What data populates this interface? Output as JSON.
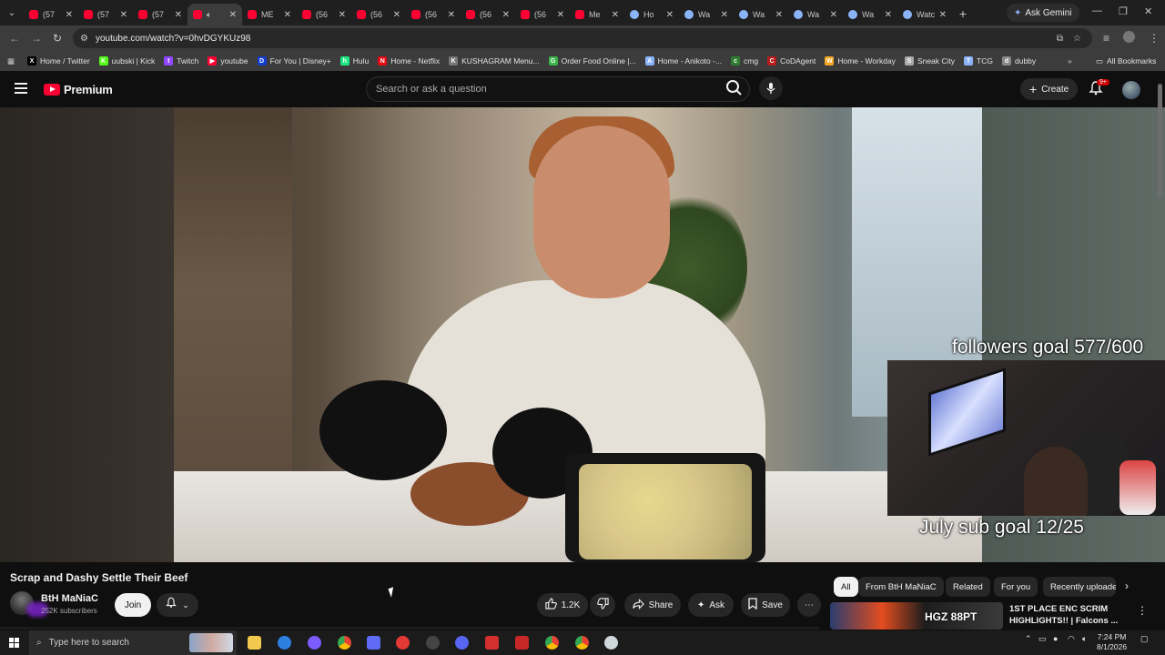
{
  "browser": {
    "tabs": [
      {
        "title": "(57",
        "icon": "youtube-icon"
      },
      {
        "title": "(57",
        "icon": "youtube-icon"
      },
      {
        "title": "(57",
        "icon": "youtube-icon"
      },
      {
        "title": "",
        "icon": "youtube-icon",
        "active": true,
        "muted_icon": "speaker-icon"
      },
      {
        "title": "ME",
        "icon": "youtube-icon"
      },
      {
        "title": "(56",
        "icon": "youtube-icon"
      },
      {
        "title": "(56",
        "icon": "youtube-icon"
      },
      {
        "title": "(56",
        "icon": "youtube-icon"
      },
      {
        "title": "(56",
        "icon": "youtube-icon"
      },
      {
        "title": "(56",
        "icon": "youtube-icon"
      },
      {
        "title": "Me",
        "icon": "youtube-icon"
      },
      {
        "title": "Ho",
        "icon": "globe-icon"
      },
      {
        "title": "Wa",
        "icon": "globe-icon"
      },
      {
        "title": "Wa",
        "icon": "globe-icon"
      },
      {
        "title": "Wa",
        "icon": "globe-icon"
      },
      {
        "title": "Wa",
        "icon": "globe-icon"
      },
      {
        "title": "Watch",
        "icon": "globe-icon"
      }
    ],
    "new_tab": "+",
    "ask_gemini": "Ask Gemini",
    "url": "youtube.com/watch?v=0hvDGYKUz98",
    "bookmarks": [
      {
        "label": "Home / Twitter",
        "color": "#000000",
        "glyph": "X"
      },
      {
        "label": "uubski | Kick",
        "color": "#53fc18",
        "glyph": "K"
      },
      {
        "label": "Twitch",
        "color": "#9146ff",
        "glyph": "t"
      },
      {
        "label": "youtube",
        "color": "#ff0033",
        "glyph": "▶"
      },
      {
        "label": "For You | Disney+",
        "color": "#113ccf",
        "glyph": "D"
      },
      {
        "label": "Hulu",
        "color": "#1ce783",
        "glyph": "h"
      },
      {
        "label": "Home - Netflix",
        "color": "#e50914",
        "glyph": "N"
      },
      {
        "label": "KUSHAGRAM Menu...",
        "color": "#777777",
        "glyph": "K"
      },
      {
        "label": "Order Food Online |...",
        "color": "#3ab54a",
        "glyph": "G"
      },
      {
        "label": "Home - Anikoto -...",
        "color": "#8ab4f8",
        "glyph": "A"
      },
      {
        "label": "cmg",
        "color": "#2e7d32",
        "glyph": "c"
      },
      {
        "label": "CoDAgent",
        "color": "#b71c1c",
        "glyph": "C"
      },
      {
        "label": "Home - Workday",
        "color": "#f5a623",
        "glyph": "W"
      },
      {
        "label": "Sneak City",
        "color": "#aaaaaa",
        "glyph": "S"
      },
      {
        "label": "TCG",
        "color": "#8ab4f8",
        "glyph": "T"
      },
      {
        "label": "dubby",
        "color": "#888888",
        "glyph": "d"
      }
    ],
    "all_bookmarks": "All Bookmarks"
  },
  "youtube": {
    "brand": "Premium",
    "search_placeholder": "Search or ask a question",
    "create_label": "Create",
    "notification_badge": "9+",
    "overlay_followers": "followers goal 577/600",
    "overlay_sub": "July sub goal 12/25",
    "video_title": "Scrap and Dashy Settle Their Beef",
    "channel_name": "BtH MaNiaC",
    "channel_subs": "252K subscribers",
    "join_label": "Join",
    "like_count": "1.2K",
    "share_label": "Share",
    "ask_label": "Ask",
    "save_label": "Save",
    "chips": [
      "All",
      "From BtH MaNiaC",
      "Related",
      "For you",
      "Recently uploaded"
    ],
    "rec_thumb_text": "HGZ 88PT",
    "rec_title": "1ST PLACE ENC SCRIM HIGHLIGHTS!! | Falcons ..."
  },
  "taskbar": {
    "search_placeholder": "Type here to search",
    "time": "7:24 PM",
    "date": "8/1/2026"
  },
  "colors": {
    "youtube_red": "#ff0033",
    "page_bg": "#0f0f0f",
    "chip_bg": "#272727"
  }
}
